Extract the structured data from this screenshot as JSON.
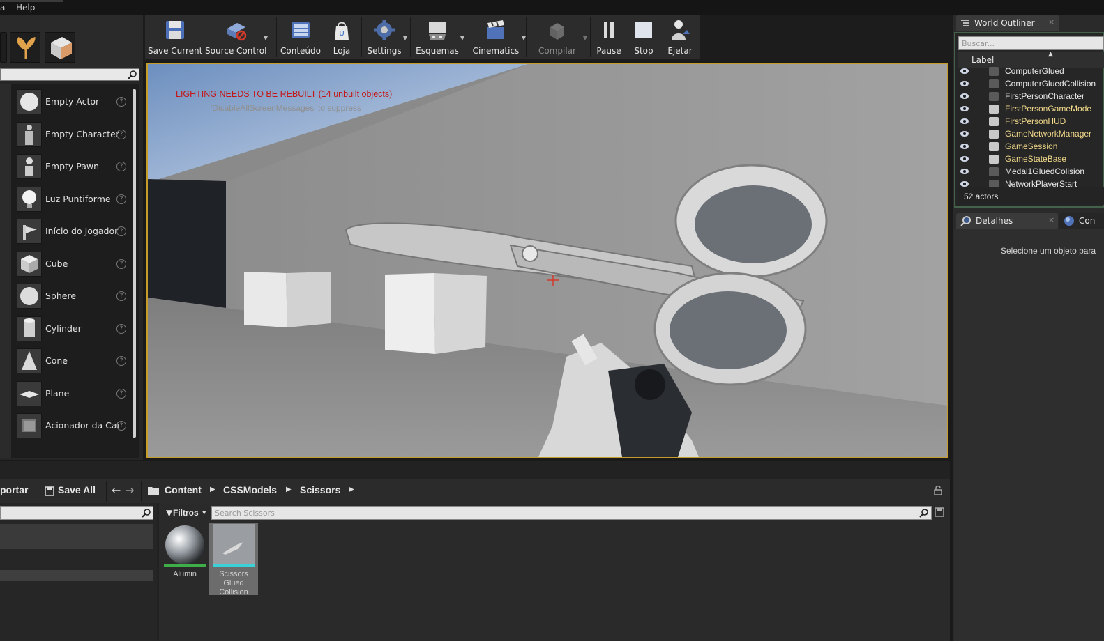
{
  "menu": {
    "help": "Help"
  },
  "place_items": [
    {
      "label": "Empty Actor"
    },
    {
      "label": "Empty Character"
    },
    {
      "label": "Empty Pawn"
    },
    {
      "label": "Luz Puntiforme"
    },
    {
      "label": "Início do Jogador"
    },
    {
      "label": "Cube"
    },
    {
      "label": "Sphere"
    },
    {
      "label": "Cylinder"
    },
    {
      "label": "Cone"
    },
    {
      "label": "Plane"
    },
    {
      "label": "Acionador da Cai"
    }
  ],
  "toolbar": {
    "save_current": "Save Current",
    "source_control": "Source Control",
    "conteudo": "Conteúdo",
    "loja": "Loja",
    "settings": "Settings",
    "esquemas": "Esquemas",
    "cinematics": "Cinematics",
    "compilar": "Compilar",
    "pause": "Pause",
    "stop": "Stop",
    "ejetar": "Ejetar"
  },
  "viewport": {
    "lighting_warning": "LIGHTING NEEDS TO BE REBUILT (14 unbuilt objects)",
    "lighting_hint": "'DisableAllScreenMessages' to suppress"
  },
  "outliner": {
    "tab": "World Outliner",
    "search_placeholder": "Buscar...",
    "column_label": "Label",
    "rows": [
      {
        "name": "ComputerGlued",
        "color": "#e8e8e8"
      },
      {
        "name": "ComputerGluedCollision",
        "color": "#e8e8e8"
      },
      {
        "name": "FirstPersonCharacter",
        "color": "#e8e8e8"
      },
      {
        "name": "FirstPersonGameMode",
        "color": "#f2d98a"
      },
      {
        "name": "FirstPersonHUD",
        "color": "#f2d98a"
      },
      {
        "name": "GameNetworkManager",
        "color": "#f2d98a"
      },
      {
        "name": "GameSession",
        "color": "#f2d98a"
      },
      {
        "name": "GameStateBase",
        "color": "#f2d98a"
      },
      {
        "name": "Medal1GluedColision",
        "color": "#e8e8e8"
      },
      {
        "name": "NetworkPlayerStart",
        "color": "#e8e8e8"
      }
    ],
    "count": "52 actors"
  },
  "details": {
    "tab": "Detalhes",
    "second_tab": "Con",
    "empty_message": "Selecione um objeto para"
  },
  "content_browser": {
    "import": "portar",
    "save_all": "Save All",
    "path": [
      "Content",
      "CSSModels",
      "Scissors"
    ],
    "filters": "Filtros",
    "search_placeholder": "Search Scissors",
    "assets": [
      {
        "name": "Alumin"
      },
      {
        "name": "Scissors Glued Collision"
      }
    ]
  },
  "colors": {
    "viewport_border": "#c79d29",
    "outliner_border": "#44624b",
    "warning": "#c41717",
    "actor_highlight": "#f2d98a"
  }
}
